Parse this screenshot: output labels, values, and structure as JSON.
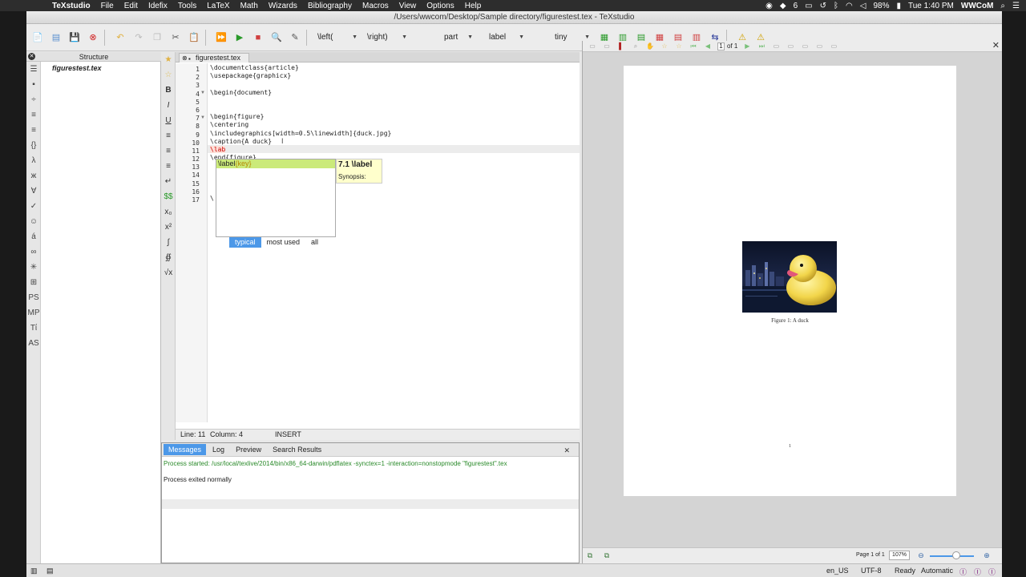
{
  "menubar": {
    "items": [
      "TeXstudio",
      "File",
      "Edit",
      "Idefix",
      "Tools",
      "LaTeX",
      "Math",
      "Wizards",
      "Bibliography",
      "Macros",
      "View",
      "Options",
      "Help"
    ],
    "battery": "98%",
    "clock": "Tue 1:40 PM",
    "user": "WWCoM",
    "badge": "6"
  },
  "window": {
    "title": "/Users/wwcom/Desktop/Sample directory/figurestest.tex - TeXstudio"
  },
  "toolbar": {
    "combo_left": "\\left(",
    "combo_right": "\\right)",
    "combo_part": "part",
    "combo_label": "label",
    "combo_size": "tiny"
  },
  "structure": {
    "title": "Structure",
    "file": "figurestest.tex"
  },
  "editor": {
    "tab_label": "figurestest.tex",
    "line_numbers": [
      "1",
      "2",
      "3",
      "4",
      "5",
      "6",
      "7",
      "8",
      "9",
      "10",
      "11",
      "12",
      "13",
      "14",
      "15",
      "16",
      "17"
    ],
    "lines": [
      "\\documentclass{article}",
      "\\usepackage{graphicx}",
      "",
      "\\begin{document}",
      "",
      "",
      "\\begin{figure}",
      "\\centering",
      "\\includegraphics[width=0.5\\linewidth]{duck.jpg}",
      "\\caption{A duck}",
      "\\lab",
      "\\end{figure}",
      "",
      "",
      "",
      "",
      "\\"
    ],
    "status_line": "Line: 11",
    "status_column": "Column: 4",
    "status_mode": "INSERT"
  },
  "completer": {
    "selected_cmd": "\\label",
    "selected_arg": "{key}",
    "tabs": [
      "typical",
      "most used",
      "all"
    ],
    "tooltip_title": "7.1 \\label",
    "tooltip_text": "Synopsis:"
  },
  "messages": {
    "tabs": [
      "Messages",
      "Log",
      "Preview",
      "Search Results"
    ],
    "line1": "Process started: /usr/local/texlive/2014/bin/x86_64-darwin/pdflatex -synctex=1 -interaction=nonstopmode \"figurestest\".tex",
    "line2": "Process exited normally"
  },
  "pdf": {
    "page_field": "1",
    "of_text": "of 1",
    "caption": "Figure 1: A duck",
    "page_number": "1",
    "page_info": "Page 1 of 1",
    "zoom": "107%"
  },
  "statusbar": {
    "language": "en_US",
    "encoding": "UTF-8",
    "ready": "Ready",
    "automatic": "Automatic"
  },
  "colors": {
    "accent": "#4c98e8",
    "completion_highlight": "#cbea7a",
    "keyword": "#1a2f9e",
    "success_text": "#2a8a2a"
  }
}
